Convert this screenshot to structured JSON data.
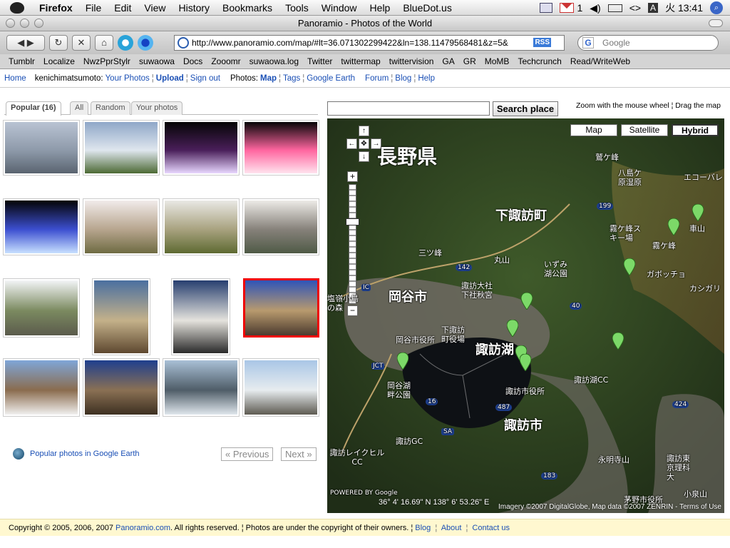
{
  "menubar": {
    "app_name": "Firefox",
    "items": [
      "File",
      "Edit",
      "View",
      "History",
      "Bookmarks",
      "Tools",
      "Window",
      "Help",
      "BlueDot.us"
    ],
    "gmail_count": "1",
    "arrows": "<>",
    "input_indicator": "A",
    "clock": "火 13:41"
  },
  "window": {
    "title": "Panoramio - Photos of the World"
  },
  "nav": {
    "url": "http://www.panoramio.com/map/#lt=36.071302299422&ln=138.11479568481&z=5&",
    "rss": "RSS",
    "search_placeholder": "Google",
    "search_engine_icon": "G"
  },
  "bookmarks": [
    "Tumblr",
    "Localize",
    "NwzPprStylr",
    "suwaowa",
    "Docs",
    "Zooomr",
    "suwaowa.log",
    "Twitter",
    "twittermap",
    "twittervision",
    "GA",
    "GR",
    "MoMB",
    "Techcrunch",
    "Read/WriteWeb"
  ],
  "sitenav": {
    "home": "Home",
    "user": "kenichimatsumoto:",
    "your_photos": "Your Photos",
    "upload": "Upload",
    "sign_out": "Sign out",
    "photos_label": "Photos:",
    "map": "Map",
    "tags": "Tags",
    "google_earth": "Google Earth",
    "forum": "Forum",
    "blog": "Blog",
    "help": "Help",
    "sep": "¦"
  },
  "tabs": [
    "Popular (16)",
    "All",
    "Random",
    "Your photos"
  ],
  "thumbs": [
    {
      "colors": [
        "#b9c3d3",
        "#8e9aaa",
        "#5a6470"
      ]
    },
    {
      "colors": [
        "#8fa7c8",
        "#dfe6ee",
        "#4d6a35"
      ]
    },
    {
      "colors": [
        "#050505",
        "#4a1f5a",
        "#e8d7ff"
      ]
    },
    {
      "colors": [
        "#070507",
        "#ff66a0",
        "#ffe3ee"
      ]
    },
    {
      "colors": [
        "#030303",
        "#3c4fd0",
        "#c8e0ff"
      ]
    },
    {
      "colors": [
        "#f1ebea",
        "#b7a58e",
        "#6e6b42"
      ]
    },
    {
      "colors": [
        "#e9e8e4",
        "#a8a27f",
        "#5e6a32"
      ]
    },
    {
      "colors": [
        "#eceae6",
        "#86817a",
        "#4f5a46"
      ]
    },
    {
      "colors": [
        "#f2f4f6",
        "#7b8a60",
        "#5b5b4c"
      ]
    },
    {
      "colors": [
        "#4a6fa0",
        "#c4b18a",
        "#5e4830"
      ]
    },
    {
      "colors": [
        "#273f6f",
        "#e5e3dd",
        "#2a2a2a"
      ]
    },
    {
      "colors": [
        "#2f54b8",
        "#b89a6e",
        "#4b3a2e"
      ]
    },
    {
      "colors": [
        "#7fa6d8",
        "#8a6c4e",
        "#f0efee"
      ]
    },
    {
      "colors": [
        "#1f3f8e",
        "#8a7054",
        "#3d3021"
      ]
    },
    {
      "colors": [
        "#a9c0d6",
        "#4f5d68",
        "#dfe6ec"
      ]
    },
    {
      "colors": [
        "#a9c6e6",
        "#e7ecef",
        "#5e5b52"
      ]
    }
  ],
  "pager": {
    "earth_link": "Popular photos in Google Earth",
    "previous": "« Previous",
    "next": "Next »"
  },
  "map": {
    "search_button": "Search place",
    "hint": "Zoom with the mouse wheel ¦ Drag the map",
    "types": [
      "Map",
      "Satellite",
      "Hybrid"
    ],
    "active_type": "Hybrid",
    "coords": "36° 4' 16.69\" N 138° 6' 53.26\" E",
    "imagery": "Imagery ©2007 DigitalGlobe, Map data ©2007 ZENRIN - Terms of Use",
    "labels": [
      {
        "text": "長野県",
        "size": "big"
      },
      {
        "text": "下諏訪町",
        "size": "med"
      },
      {
        "text": "岡谷市",
        "size": "med"
      },
      {
        "text": "諏訪市",
        "size": "med"
      },
      {
        "text": "諏訪湖",
        "size": "med"
      },
      {
        "text": "霧ケ峰",
        "size": "sm"
      },
      {
        "text": "八島ケ原湿原",
        "size": "sm"
      },
      {
        "text": "エコーバレ",
        "size": "sm"
      },
      {
        "text": "霧ケ峰スキー場",
        "size": "sm"
      },
      {
        "text": "車山",
        "size": "sm"
      },
      {
        "text": "ガボッチョ",
        "size": "sm"
      },
      {
        "text": "カシガリ",
        "size": "sm"
      },
      {
        "text": "いずみ湖公園",
        "size": "sm"
      },
      {
        "text": "諏訪大社下社秋宮",
        "size": "sm"
      },
      {
        "text": "下諏訪町役場",
        "size": "sm"
      },
      {
        "text": "岡谷市役所",
        "size": "sm"
      },
      {
        "text": "岡谷湖畔公園",
        "size": "sm"
      },
      {
        "text": "諏訪市役所",
        "size": "sm"
      },
      {
        "text": "諏訪湖CC",
        "size": "sm"
      },
      {
        "text": "諏訪GC",
        "size": "sm"
      },
      {
        "text": "諏訪レイクヒルCC",
        "size": "sm"
      },
      {
        "text": "永明寺山",
        "size": "sm"
      },
      {
        "text": "茅野市役所",
        "size": "sm"
      },
      {
        "text": "小泉山",
        "size": "sm"
      },
      {
        "text": "諏訪東京理科大",
        "size": "sm"
      },
      {
        "text": "塩嶺小鳥の森",
        "size": "sm"
      },
      {
        "text": "鷲ケ峰",
        "size": "sm"
      },
      {
        "text": "三ツ峰",
        "size": "sm"
      },
      {
        "text": "丸山",
        "size": "sm"
      },
      {
        "text": "JCT",
        "size": "sm"
      },
      {
        "text": "IC",
        "size": "sm"
      },
      {
        "text": "SA",
        "size": "sm"
      },
      {
        "text": "199",
        "size": "sm"
      },
      {
        "text": "142",
        "size": "sm"
      },
      {
        "text": "40",
        "size": "sm"
      },
      {
        "text": "487",
        "size": "sm"
      },
      {
        "text": "16",
        "size": "sm"
      },
      {
        "text": "183",
        "size": "sm"
      },
      {
        "text": "424",
        "size": "sm"
      },
      {
        "text": "POWERED BY Google",
        "size": "sm"
      }
    ]
  },
  "footer": {
    "copyright": "Copyright © 2005, 2006, 2007",
    "site": "Panoramio.com",
    "rights": ". All rights reserved. ¦ Photos are under the copyright of their owners. ¦",
    "blog": "Blog",
    "about": "About",
    "contact": "Contact us"
  }
}
